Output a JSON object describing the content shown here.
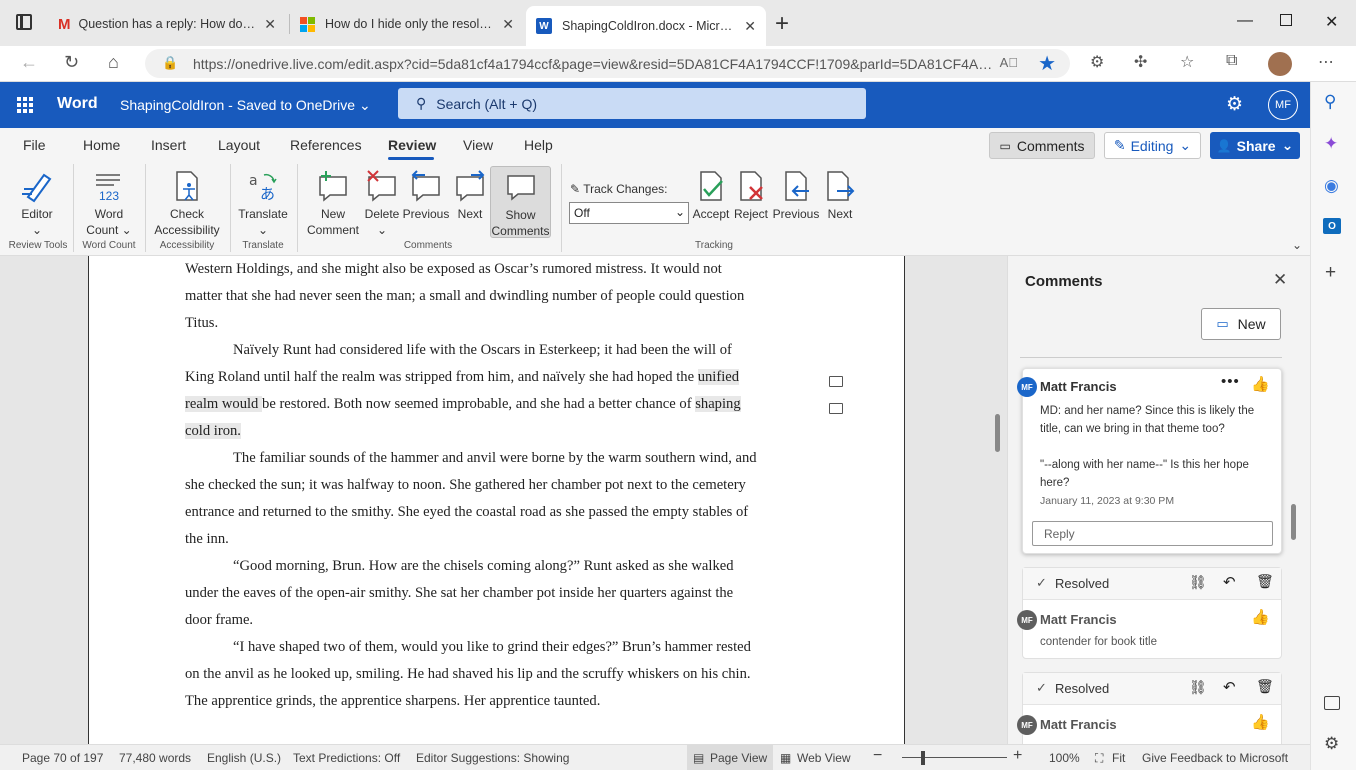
{
  "browser": {
    "tabs": [
      {
        "title": "Question has a reply: How do I h",
        "icon": "gmail-icon",
        "active": false
      },
      {
        "title": "How do I hide only the resolved",
        "icon": "microsoft-icon",
        "active": false
      },
      {
        "title": "ShapingColdIron.docx - Microsof",
        "icon": "word-icon",
        "active": true
      }
    ],
    "url": "https://onedrive.live.com/edit.aspx?cid=5da81cf4a1794ccf&page=view&resid=5DA81CF4A1794CCF!1709&parId=5DA81CF4A1...",
    "new_tab": "+"
  },
  "app": {
    "name": "Word",
    "doc_title": "ShapingColdIron",
    "save_status": "Saved to OneDrive",
    "search_placeholder": "Search (Alt + Q)",
    "user_initials": "MF"
  },
  "menu": {
    "items": [
      "File",
      "Home",
      "Insert",
      "Layout",
      "References",
      "Review",
      "View",
      "Help"
    ],
    "active": "Review"
  },
  "top_buttons": {
    "comments": "Comments",
    "editing": "Editing",
    "share": "Share"
  },
  "ribbon": {
    "editor": {
      "label": "Editor",
      "group": "Review Tools"
    },
    "word_count": {
      "label1": "Word",
      "label2": "Count",
      "group": "Word Count"
    },
    "accessibility": {
      "label1": "Check",
      "label2": "Accessibility",
      "group": "Accessibility"
    },
    "translate": {
      "label": "Translate",
      "group": "Translate"
    },
    "comments_group": {
      "new1": "New",
      "new2": "Comment",
      "delete": "Delete",
      "previous": "Previous",
      "next": "Next",
      "show1": "Show",
      "show2": "Comments",
      "group": "Comments"
    },
    "tracking_group": {
      "track_label": "Track Changes:",
      "track_value": "Off",
      "accept": "Accept",
      "reject": "Reject",
      "previous": "Previous",
      "next": "Next",
      "group": "Tracking"
    }
  },
  "document": {
    "lines": [
      {
        "text": "Western Holdings, and she might also be exposed as Oscar’s rumored mistress. It would not",
        "indent": false
      },
      {
        "text": "matter that she had never seen the man; a small and dwindling number of people could question",
        "indent": false
      },
      {
        "text": "Titus.",
        "indent": false
      },
      {
        "text": "Naïvely Runt had considered life with the Oscars in Esterkeep; it had been the will of",
        "indent": true
      },
      {
        "text": "King Roland until half the realm was stripped from him, and naïvely she had hoped the ",
        "hl": "unified",
        "indent": false
      },
      {
        "hl": "realm would ",
        "text": "be restored. Both now seemed improbable, and she had a better chance of ",
        "hl2": "shaping",
        "indent": false
      },
      {
        "hl": "cold iron.",
        "text": "",
        "indent": false
      },
      {
        "text": "The familiar sounds of the hammer and anvil were borne by the warm southern wind, and",
        "indent": true
      },
      {
        "text": "she checked the sun; it was halfway to noon. She gathered her chamber pot next to the cemetery",
        "indent": false
      },
      {
        "text": "entrance and returned to the smithy. She eyed the coastal road as she passed the empty stables of",
        "indent": false
      },
      {
        "text": "the inn.",
        "indent": false
      },
      {
        "text": "“Good morning, Brun. How are the chisels coming along?” Runt asked as she walked",
        "indent": true
      },
      {
        "text": "under the eaves of the open-air smithy. She sat her chamber pot inside her quarters against the",
        "indent": false
      },
      {
        "text": "door frame.",
        "indent": false
      },
      {
        "text": "“I have shaped two of them, would you like to grind their edges?” Brun’s hammer rested",
        "indent": true
      },
      {
        "text": "on the anvil as he looked up, smiling. He had shaved his lip and the scruffy whiskers on his chin.",
        "indent": false
      },
      {
        "text": "The apprentice grinds, the apprentice sharpens. Her apprentice taunted.",
        "indent": false
      }
    ]
  },
  "comments_pane": {
    "title": "Comments",
    "new_button": "New",
    "active_comment": {
      "author": "Matt Francis",
      "initials": "MF",
      "text1": "MD: and her name? Since this is likely the title, can we bring in that theme too?",
      "text2": "\"--along with her name--\" Is this her hope here?",
      "date": "January 11, 2023 at 9:30 PM",
      "reply_placeholder": "Reply"
    },
    "resolved": [
      {
        "status": "Resolved",
        "author": "Matt Francis",
        "initials": "MF",
        "text": "contender for book title"
      },
      {
        "status": "Resolved",
        "author": "Matt Francis",
        "initials": "MF",
        "text": ""
      }
    ]
  },
  "status": {
    "page": "Page 70 of 197",
    "words": "77,480 words",
    "language": "English (U.S.)",
    "predictions": "Text Predictions: Off",
    "suggestions": "Editor Suggestions: Showing",
    "page_view": "Page View",
    "web_view": "Web View",
    "zoom": "100%",
    "fit": "Fit",
    "feedback": "Give Feedback to Microsoft"
  },
  "colors": {
    "word_blue": "#185abd",
    "avatar_blue": "#1a66c9",
    "avatar_gray": "#5e5e5e"
  }
}
